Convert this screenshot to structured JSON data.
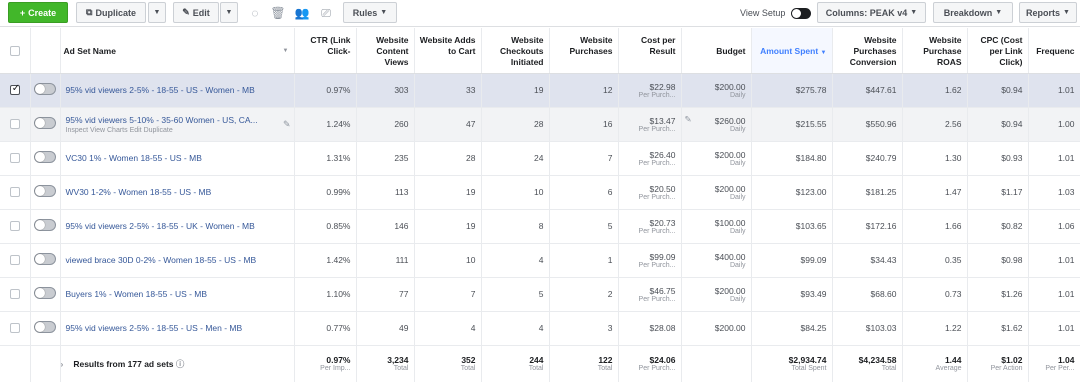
{
  "toolbar": {
    "create": "Create",
    "duplicate": "Duplicate",
    "edit": "Edit",
    "rules": "Rules",
    "view_setup": "View Setup",
    "columns": "Columns: PEAK v4",
    "breakdown": "Breakdown",
    "reports": "Reports"
  },
  "columns": {
    "ad_set_name": "Ad Set Name",
    "ctr": "CTR (Link Click-",
    "content_views": "Website Content Views",
    "adds_to_cart": "Website Adds to Cart",
    "checkouts": "Website Checkouts Initiated",
    "purchases": "Website Purchases",
    "cost_per_result": "Cost per Result",
    "budget": "Budget",
    "amount_spent": "Amount Spent",
    "purchases_conversion": "Website Purchases Conversion",
    "purchase_roas": "Website Purchase ROAS",
    "cpc": "CPC (Cost per Link Click)",
    "frequency": "Frequenc"
  },
  "rows": [
    {
      "name": "95% vid viewers 2-5% - 18-55 - US - Women - MB",
      "ctr": "0.97%",
      "views": "303",
      "cart": "33",
      "checkouts": "19",
      "purchases": "12",
      "cpr": "$22.98",
      "cpr_sub": "Per Purch...",
      "budget": "$200.00",
      "budget_sub": "Daily",
      "spent": "$275.78",
      "conv": "$447.61",
      "roas": "1.62",
      "cpc": "$0.94",
      "freq": "1.01"
    },
    {
      "name": "95% vid viewers 5-10% - 35-60 Women - US, CA...",
      "ctr": "1.24%",
      "views": "260",
      "cart": "47",
      "checkouts": "28",
      "purchases": "16",
      "cpr": "$13.47",
      "cpr_sub": "Per Purch...",
      "budget": "$260.00",
      "budget_sub": "Daily",
      "spent": "$215.55",
      "conv": "$550.96",
      "roas": "2.56",
      "cpc": "$0.94",
      "freq": "1.00",
      "actions": "Inspect  View Charts  Edit  Duplicate"
    },
    {
      "name": "VC30 1% - Women 18-55 - US - MB",
      "ctr": "1.31%",
      "views": "235",
      "cart": "28",
      "checkouts": "24",
      "purchases": "7",
      "cpr": "$26.40",
      "cpr_sub": "Per Purch...",
      "budget": "$200.00",
      "budget_sub": "Daily",
      "spent": "$184.80",
      "conv": "$240.79",
      "roas": "1.30",
      "cpc": "$0.93",
      "freq": "1.01"
    },
    {
      "name": "WV30 1-2% - Women 18-55 - US - MB",
      "ctr": "0.99%",
      "views": "113",
      "cart": "19",
      "checkouts": "10",
      "purchases": "6",
      "cpr": "$20.50",
      "cpr_sub": "Per Purch...",
      "budget": "$200.00",
      "budget_sub": "Daily",
      "spent": "$123.00",
      "conv": "$181.25",
      "roas": "1.47",
      "cpc": "$1.17",
      "freq": "1.03"
    },
    {
      "name": "95% vid viewers 2-5% - 18-55 - UK - Women - MB",
      "ctr": "0.85%",
      "views": "146",
      "cart": "19",
      "checkouts": "8",
      "purchases": "5",
      "cpr": "$20.73",
      "cpr_sub": "Per Purch...",
      "budget": "$100.00",
      "budget_sub": "Daily",
      "spent": "$103.65",
      "conv": "$172.16",
      "roas": "1.66",
      "cpc": "$0.82",
      "freq": "1.06"
    },
    {
      "name": "viewed brace 30D 0-2% - Women 18-55 - US - MB",
      "ctr": "1.42%",
      "views": "111",
      "cart": "10",
      "checkouts": "4",
      "purchases": "1",
      "cpr": "$99.09",
      "cpr_sub": "Per Purch...",
      "budget": "$400.00",
      "budget_sub": "Daily",
      "spent": "$99.09",
      "conv": "$34.43",
      "roas": "0.35",
      "cpc": "$0.98",
      "freq": "1.01"
    },
    {
      "name": "Buyers 1% - Women 18-55 - US - MB",
      "ctr": "1.10%",
      "views": "77",
      "cart": "7",
      "checkouts": "5",
      "purchases": "2",
      "cpr": "$46.75",
      "cpr_sub": "Per Purch...",
      "budget": "$200.00",
      "budget_sub": "Daily",
      "spent": "$93.49",
      "conv": "$68.60",
      "roas": "0.73",
      "cpc": "$1.26",
      "freq": "1.01"
    },
    {
      "name": "95% vid viewers 2-5% - 18-55 - US - Men - MB",
      "ctr": "0.77%",
      "views": "49",
      "cart": "4",
      "checkouts": "4",
      "purchases": "3",
      "cpr": "$28.08",
      "cpr_sub": "",
      "budget": "$200.00",
      "budget_sub": "",
      "spent": "$84.25",
      "conv": "$103.03",
      "roas": "1.22",
      "cpc": "$1.62",
      "freq": "1.01"
    }
  ],
  "totals": {
    "label": "Results from 177 ad sets",
    "ctr": "0.97%",
    "ctr_sub": "Per Imp...",
    "views": "3,234",
    "views_sub": "Total",
    "cart": "352",
    "cart_sub": "Total",
    "checkouts": "244",
    "checkouts_sub": "Total",
    "purchases": "122",
    "purchases_sub": "Total",
    "cpr": "$24.06",
    "cpr_sub": "Per Purch...",
    "spent": "$2,934.74",
    "spent_sub": "Total Spent",
    "conv": "$4,234.58",
    "conv_sub": "Total",
    "roas": "1.44",
    "roas_sub": "Average",
    "cpc": "$1.02",
    "cpc_sub": "Per Action",
    "freq": "1.04",
    "freq_sub": "Per Per..."
  }
}
